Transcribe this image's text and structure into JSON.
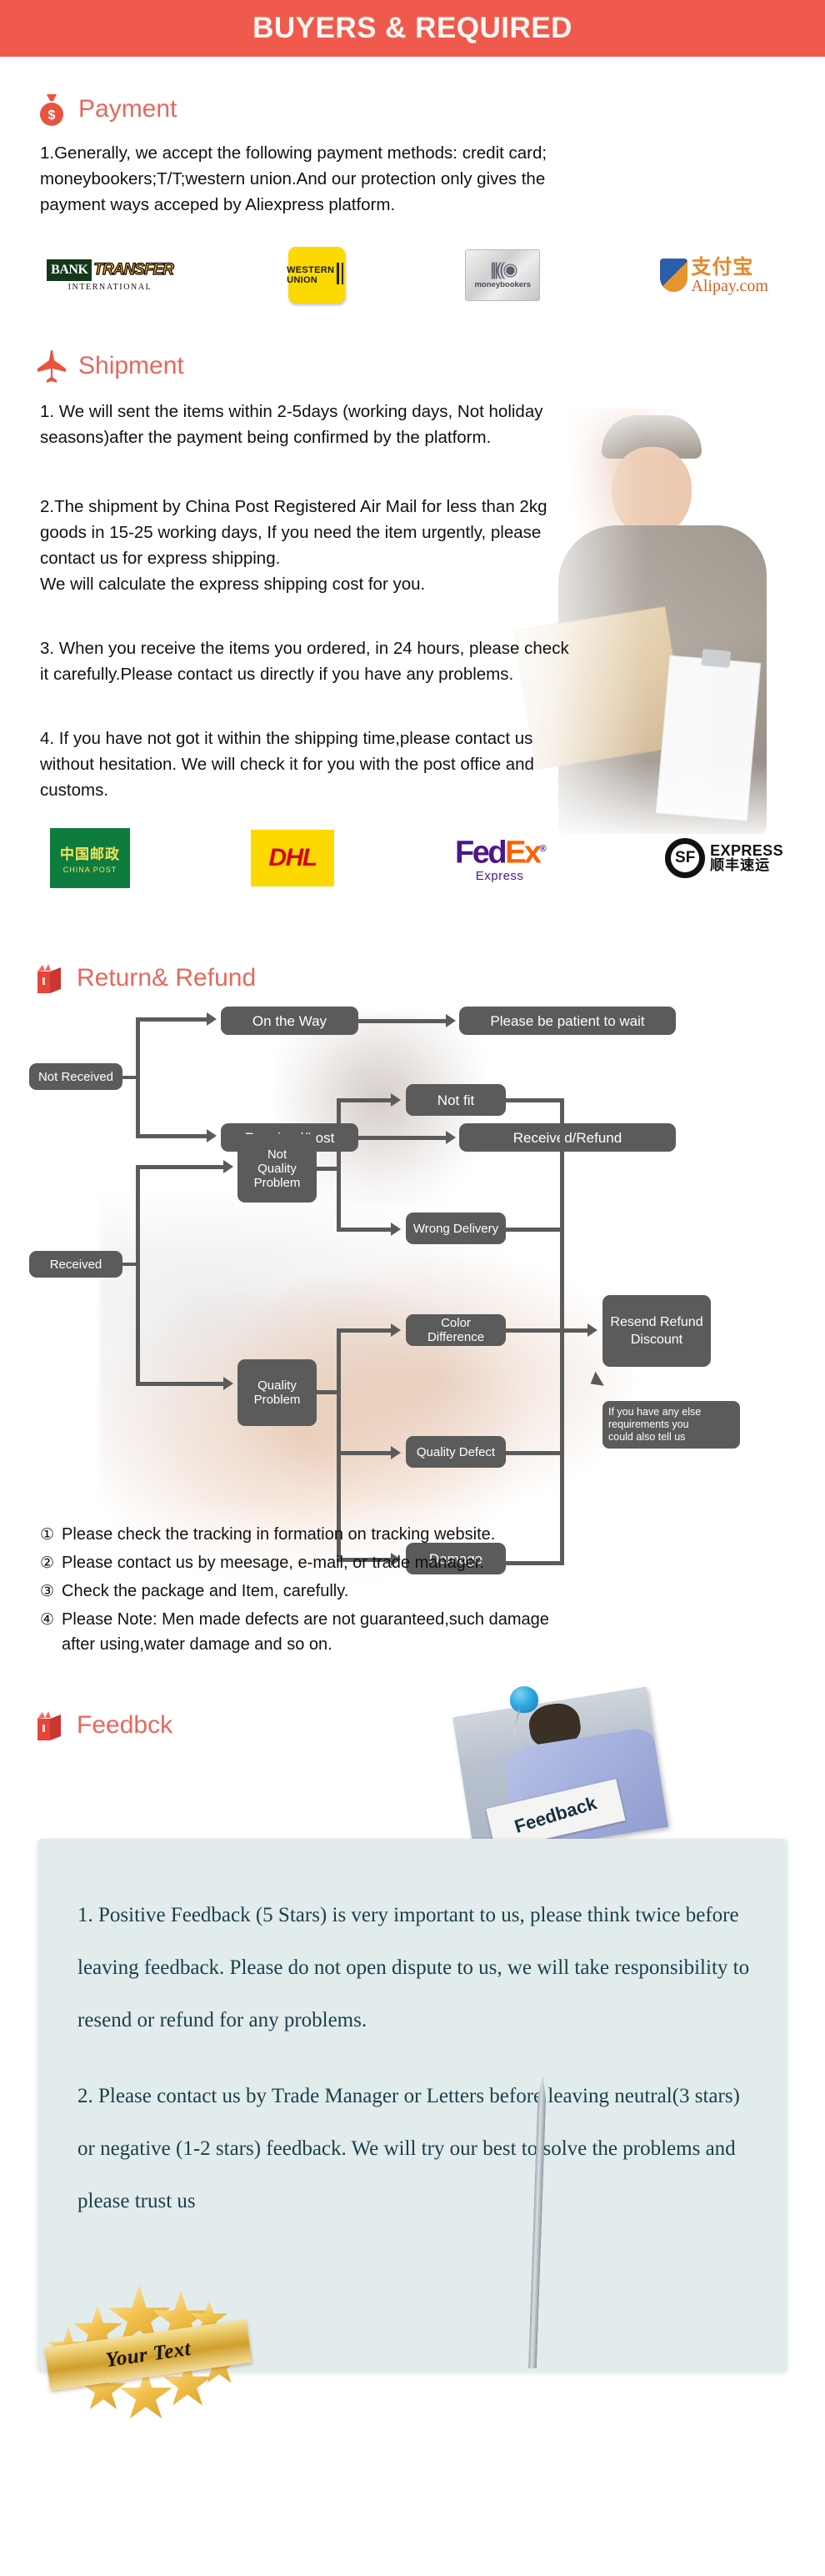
{
  "header": {
    "title": "BUYERS & REQUIRED"
  },
  "sections": {
    "payment": {
      "heading": "Payment",
      "icon": "money-bag-icon",
      "paragraph": "1.Generally, we accept the following payment methods: credit card;\nmoneybookers;T/T;western union.And our protection only gives the\npayment ways acceped by Aliexpress platform.",
      "logos": [
        {
          "name": "bank-transfer",
          "line1": "BANK",
          "line2": "TRANSFER",
          "line3": "INTERNATIONAL"
        },
        {
          "name": "western-union",
          "line1": "WESTERN",
          "line2": "UNION"
        },
        {
          "name": "moneybookers",
          "line1": "moneybookers"
        },
        {
          "name": "alipay",
          "line1": "支付宝",
          "line2": "Alipay.com"
        }
      ]
    },
    "shipment": {
      "heading": "Shipment",
      "icon": "airplane-icon",
      "paragraphs": [
        "1. We will sent the items within 2-5days (working days, Not holiday\nseasons)after the payment being confirmed by the platform.",
        "2.The shipment by China Post Registered Air Mail for less than  2kg\ngoods in 15-25 working days, If  you need the item urgently, please\ncontact us for express shipping.\nWe will calculate the express shipping cost for you.",
        "3. When you receive the items you ordered, in 24 hours, please check\n it carefully.Please contact us directly if you have any problems.",
        "4. If you have not got it within the shipping time,please contact us\nwithout hesitation. We will check it for you with the post office and\ncustoms."
      ],
      "logos": [
        {
          "name": "china-post",
          "line1": "中国邮政",
          "line2": "CHINA POST"
        },
        {
          "name": "dhl",
          "line1": "DHL"
        },
        {
          "name": "fedex",
          "line1": "Fed",
          "line2": "Ex",
          "line3": "Express",
          "mark": "®"
        },
        {
          "name": "sf-express",
          "line1": "SF",
          "line2": "EXPRESS",
          "line3": "顺丰速运"
        }
      ]
    },
    "return_refund": {
      "heading": "Return& Refund",
      "icon": "open-box-icon",
      "flow": {
        "not_received": "Not Received",
        "on_the_way": "On the Way",
        "please_wait": "Please be patient to wait",
        "received_lost": "Received/Lost",
        "received_refund_out": "Received/Refund",
        "received": "Received",
        "not_quality_problem": "Not\nQuality\nProblem",
        "quality_problem": "Quality\nProblem",
        "not_fit": "Not fit",
        "wrong_delivery": "Wrong Delivery",
        "color_difference": "Color Difference",
        "quality_defect": "Quality Defect",
        "damage": "Damage",
        "resend_refund_discount": "Resend\nRefund\nDiscount",
        "callout": "If you have any else\nrequirements you\ncould also tell us"
      },
      "notes": [
        {
          "marker": "①",
          "text": "Please check the tracking in formation on tracking website."
        },
        {
          "marker": "②",
          "text": "Please contact us by meesage, e-mail, or trade manager."
        },
        {
          "marker": "③",
          "text": "Check the package and Item, carefully."
        },
        {
          "marker": "④",
          "text": "Please Note: Men made defects  are not guaranteed,such damage\n     after using,water damage and so on."
        }
      ]
    },
    "feedback": {
      "heading": "Feedbck",
      "icon": "open-box-icon",
      "photo_sign_text": "Feedback",
      "paragraphs": [
        "1. Positive Feedback (5 Stars) is very important to us, please think twice before leaving feedback. Please do not open dispute to us,   we will take responsibility to resend or refund for any problems.",
        "2. Please contact us by Trade Manager or Letters before leaving neutral(3 stars) or negative (1-2 stars) feedback. We will try our best to solve the problems and please trust us"
      ],
      "badge_text": "Your Text"
    }
  },
  "colors": {
    "header_bg": "#ef5a4c",
    "heading_text": "#e8675b",
    "flow_node": "#5b5b5b",
    "feedback_box": "#e2ecec",
    "feedback_text": "#1b3e4b"
  }
}
